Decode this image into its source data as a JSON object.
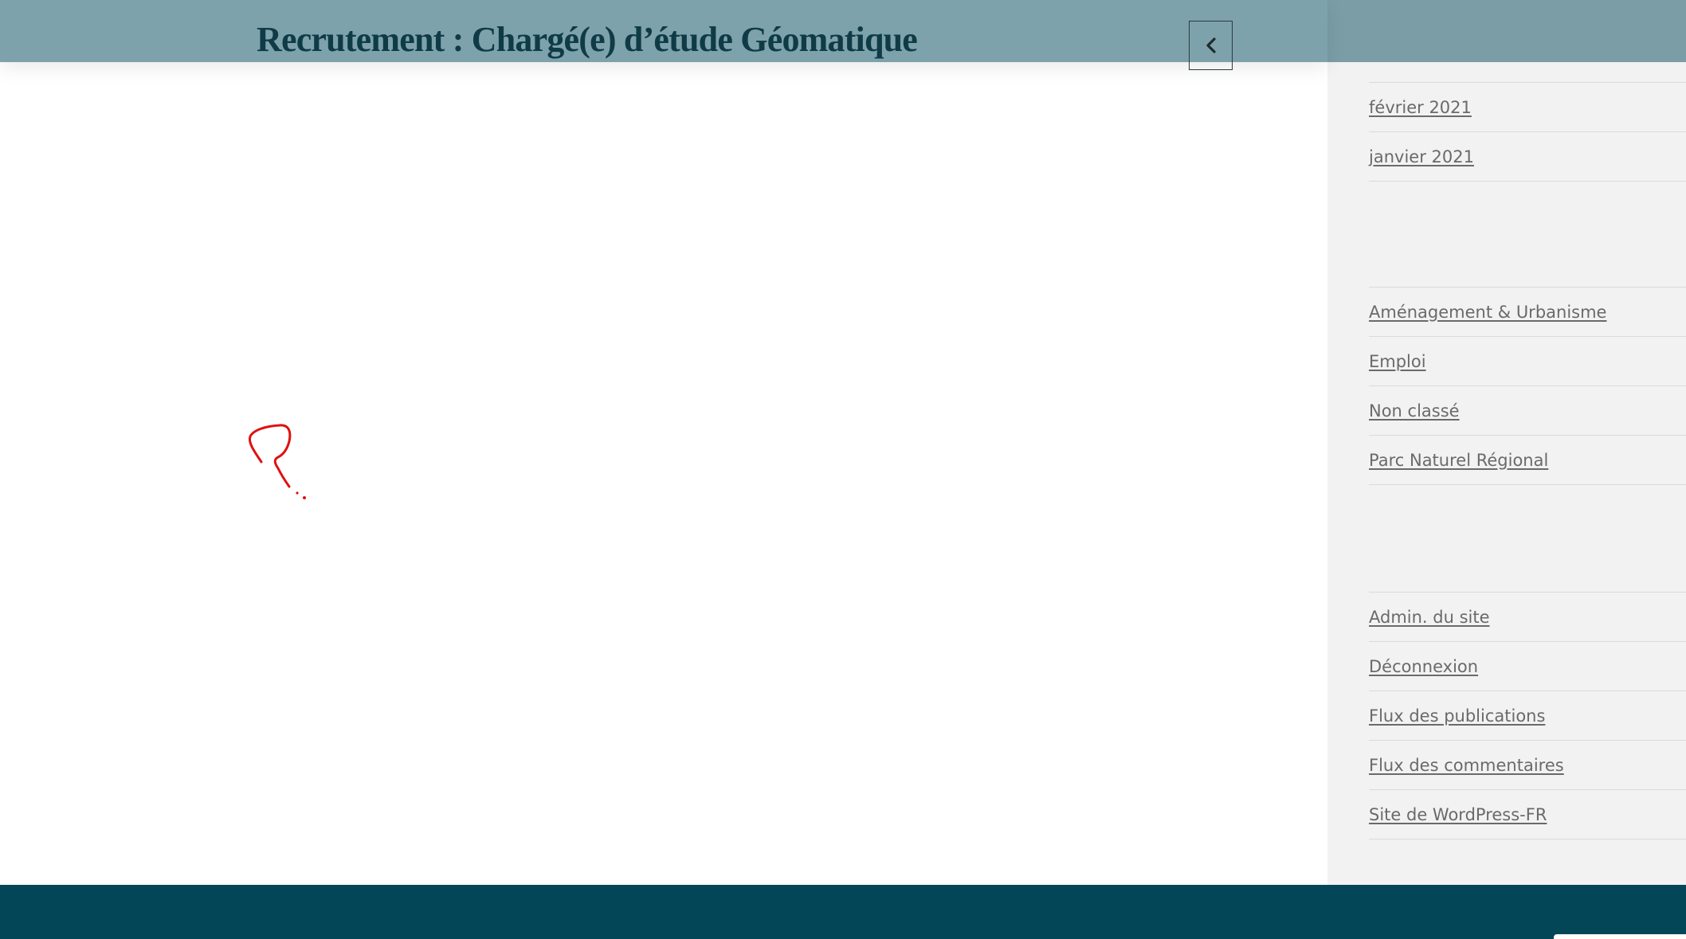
{
  "header": {
    "title": "Recrutement : Chargé(e) d’étude Géomatique",
    "back_icon": "chevron-left-icon"
  },
  "sidebar": {
    "archives": [
      {
        "label": "février 2021"
      },
      {
        "label": "janvier 2021"
      }
    ],
    "categories": [
      {
        "label": "Aménagement & Urbanisme"
      },
      {
        "label": "Emploi"
      },
      {
        "label": "Non classé"
      },
      {
        "label": "Parc Naturel Régional"
      }
    ],
    "meta": [
      {
        "label": "Admin. du site"
      },
      {
        "label": "Déconnexion"
      },
      {
        "label": "Flux des publications"
      },
      {
        "label": "Flux des commentaires"
      },
      {
        "label": "Site de WordPress-FR"
      }
    ]
  },
  "colors": {
    "header_bg": "#7da2ab",
    "title_text": "#0f3b47",
    "sidebar_bg": "#f2f2f2",
    "link_text": "#6a6a6a",
    "footer_bg": "#024658",
    "annotation": "#e01010"
  }
}
